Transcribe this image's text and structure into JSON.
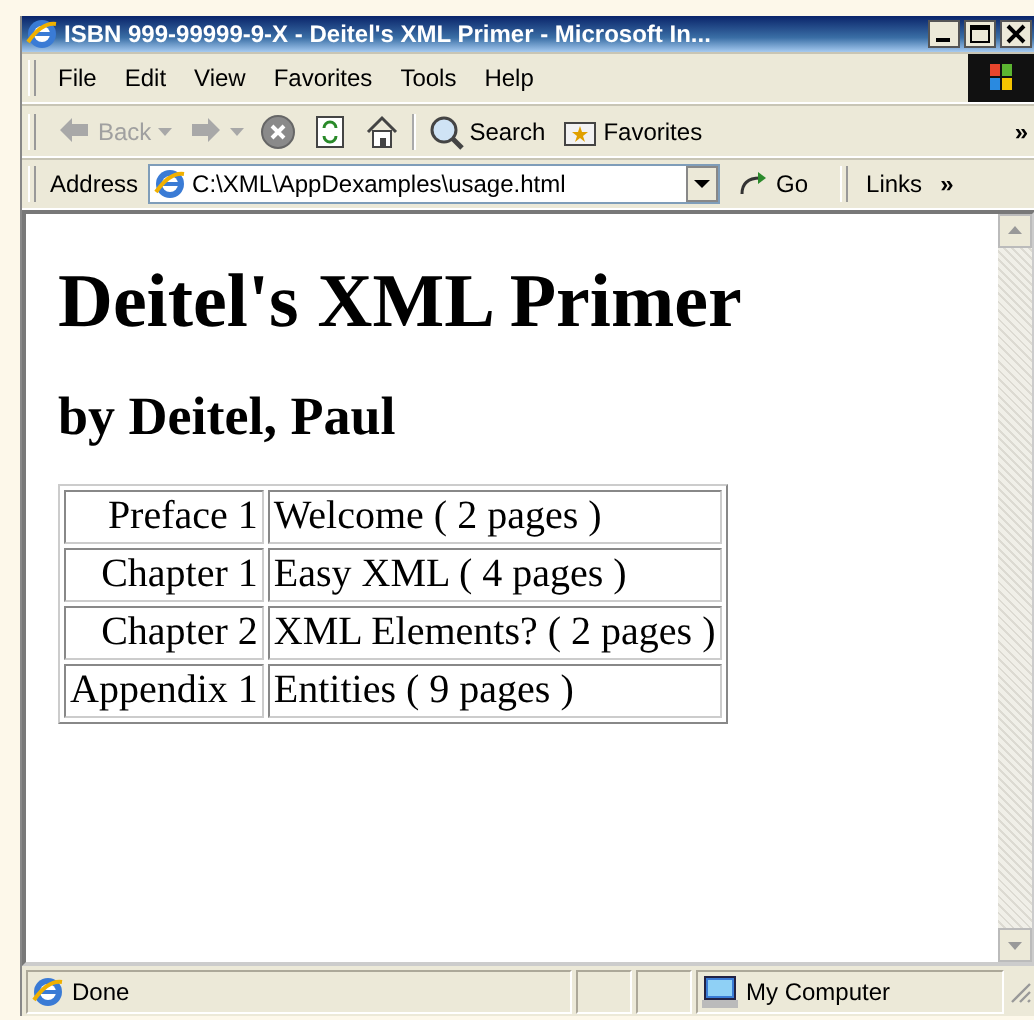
{
  "window": {
    "title": "ISBN 999-99999-9-X - Deitel's XML Primer - Microsoft In..."
  },
  "menu": [
    "File",
    "Edit",
    "View",
    "Favorites",
    "Tools",
    "Help"
  ],
  "toolbar": [
    {
      "kind": "back",
      "label": "Back",
      "disabled": true
    },
    {
      "kind": "forward",
      "disabled": true
    },
    {
      "kind": "stop",
      "disabled": false
    },
    {
      "kind": "refresh",
      "disabled": false
    },
    {
      "kind": "home",
      "disabled": false
    },
    {
      "kind": "search",
      "label": "Search",
      "disabled": false
    },
    {
      "kind": "favorites",
      "label": "Favorites",
      "disabled": false
    }
  ],
  "toolbar_more": "»",
  "address_bar": {
    "label": "Address",
    "value": "C:\\XML\\AppDexamples\\usage.html",
    "go": "Go",
    "links": "Links",
    "more": "»"
  },
  "page": {
    "heading": "Deitel's XML Primer",
    "subheading": "by Deitel, Paul",
    "rows": [
      {
        "part": "Preface 1",
        "title": "Welcome ( 2 pages )"
      },
      {
        "part": "Chapter 1",
        "title": "Easy XML ( 4 pages )"
      },
      {
        "part": "Chapter 2",
        "title": "XML Elements? ( 2 pages )"
      },
      {
        "part": "Appendix 1",
        "title": "Entities ( 9 pages )"
      }
    ]
  },
  "status_bar": {
    "text": "Done",
    "zone": "My Computer"
  }
}
